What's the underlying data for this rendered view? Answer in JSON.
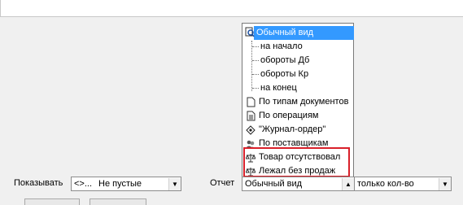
{
  "dropdown": {
    "items": [
      {
        "label": "Обычный вид",
        "icon": "magnifier-doc-icon",
        "selected": true
      },
      {
        "label": "на начало"
      },
      {
        "label": "обороты Дб"
      },
      {
        "label": "обороты Кр"
      },
      {
        "label": "на конец"
      },
      {
        "label": "По типам документов",
        "icon": "document-icon"
      },
      {
        "label": "По операциям",
        "icon": "document-lines-icon"
      },
      {
        "label": "\"Журнал-ордер\"",
        "icon": "diamond-icon"
      },
      {
        "label": "По поставщикам",
        "icon": "people-icon"
      },
      {
        "label": "Товар отсутствовал",
        "icon": "scales-icon"
      },
      {
        "label": "Лежал без продаж",
        "icon": "scales-icon"
      }
    ]
  },
  "bottom": {
    "show_label": "Показывать",
    "show_combo_prefix": "<>...",
    "show_combo_value": "Не пустые",
    "report_label": "Отчет",
    "report_combo_value": "Обычный вид",
    "qty_combo_value": "только кол-во"
  },
  "colors": {
    "selection": "#3399ff",
    "highlight": "#d9202a"
  }
}
